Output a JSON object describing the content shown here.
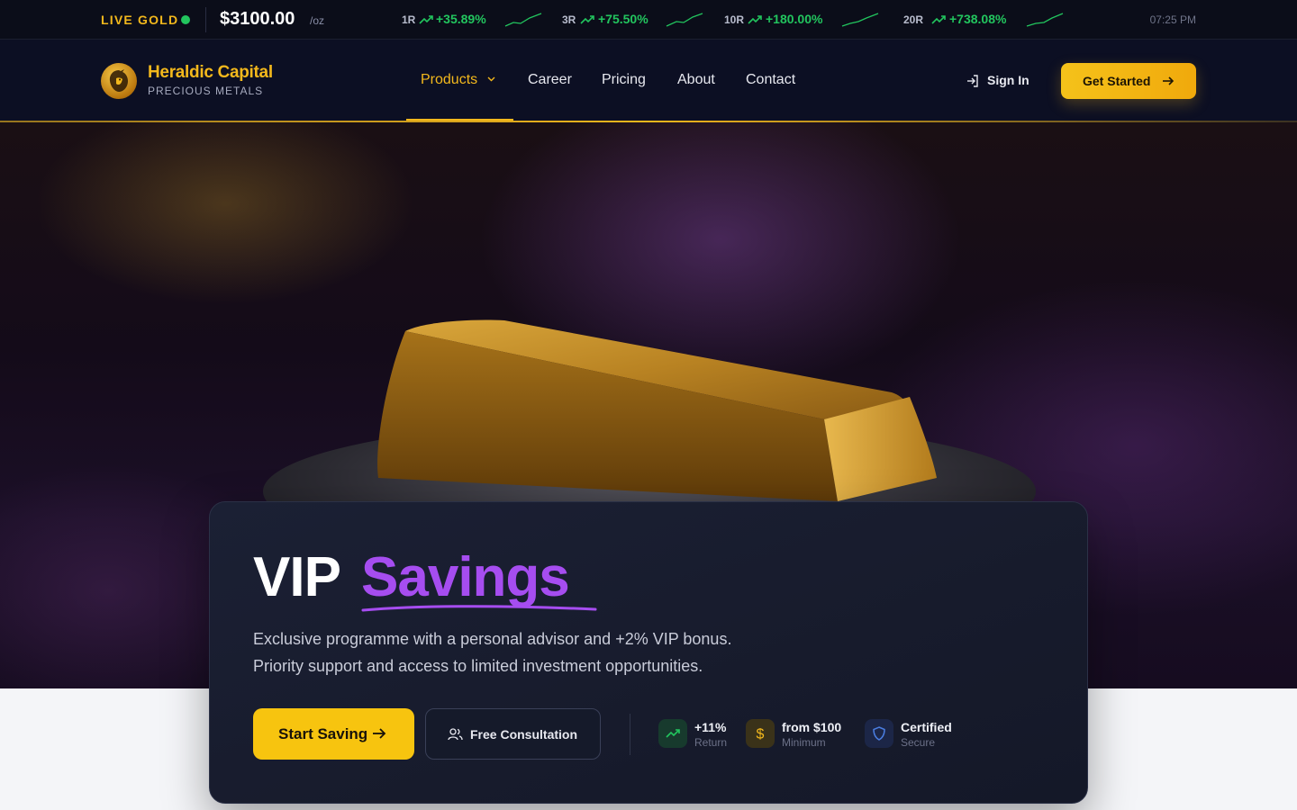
{
  "ticker": {
    "live_label": "LIVE GOLD",
    "price": "$3100.00",
    "unit": "/oz",
    "performance": [
      {
        "period": "1R",
        "change": "+35.89%"
      },
      {
        "period": "3R",
        "change": "+75.50%"
      },
      {
        "period": "10R",
        "change": "+180.00%"
      },
      {
        "period": "20R",
        "change": "+738.08%"
      }
    ],
    "time": "07:25 PM"
  },
  "brand": {
    "name": "Heraldic Capital",
    "tagline": "PRECIOUS METALS"
  },
  "nav": {
    "items": [
      {
        "label": "Products"
      },
      {
        "label": "Career"
      },
      {
        "label": "Pricing"
      },
      {
        "label": "About"
      },
      {
        "label": "Contact"
      }
    ],
    "active": "Products",
    "sign_in": "Sign In",
    "cta": "Get Started"
  },
  "hero": {
    "title_plain": "VIP",
    "title_highlight": "Savings",
    "description_line1": "Exclusive programme with a personal advisor and +2% VIP bonus.",
    "description_line2": "Priority support and access to limited investment opportunities.",
    "primary_cta": "Start Saving",
    "secondary_cta": "Free Consultation",
    "stats": [
      {
        "value": "+11%",
        "label": "Return",
        "icon": "trending-up-icon"
      },
      {
        "value": "from $100",
        "label": "Minimum",
        "icon": "dollar-icon"
      },
      {
        "value": "Certified",
        "label": "Secure",
        "icon": "shield-icon"
      }
    ]
  },
  "colors": {
    "gold": "#f3b81c",
    "purple": "#a64df0",
    "positive": "#22c55e",
    "navy": "#0c0f23"
  }
}
